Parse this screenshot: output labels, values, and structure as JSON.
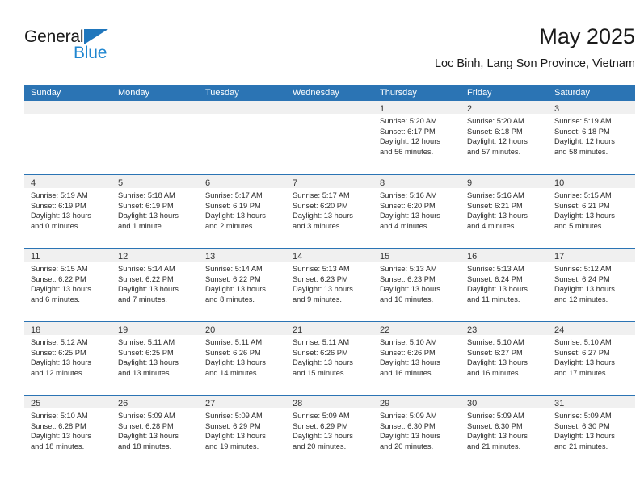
{
  "brand": {
    "name_top": "General",
    "name_bottom": "Blue",
    "triangle_color": "#1f76bc",
    "blue_text_color": "#1f86d0"
  },
  "header": {
    "month_title": "May 2025",
    "location": "Loc Binh, Lang Son Province, Vietnam"
  },
  "theme": {
    "header_blue": "#2b74b4",
    "day_band_gray": "#f0f0f0",
    "text_dark": "#2b2b2b"
  },
  "weekdays": [
    "Sunday",
    "Monday",
    "Tuesday",
    "Wednesday",
    "Thursday",
    "Friday",
    "Saturday"
  ],
  "weeks": [
    [
      {
        "day": "",
        "lines": []
      },
      {
        "day": "",
        "lines": []
      },
      {
        "day": "",
        "lines": []
      },
      {
        "day": "",
        "lines": []
      },
      {
        "day": "1",
        "lines": [
          "Sunrise: 5:20 AM",
          "Sunset: 6:17 PM",
          "Daylight: 12 hours",
          "and 56 minutes."
        ]
      },
      {
        "day": "2",
        "lines": [
          "Sunrise: 5:20 AM",
          "Sunset: 6:18 PM",
          "Daylight: 12 hours",
          "and 57 minutes."
        ]
      },
      {
        "day": "3",
        "lines": [
          "Sunrise: 5:19 AM",
          "Sunset: 6:18 PM",
          "Daylight: 12 hours",
          "and 58 minutes."
        ]
      }
    ],
    [
      {
        "day": "4",
        "lines": [
          "Sunrise: 5:19 AM",
          "Sunset: 6:19 PM",
          "Daylight: 13 hours",
          "and 0 minutes."
        ]
      },
      {
        "day": "5",
        "lines": [
          "Sunrise: 5:18 AM",
          "Sunset: 6:19 PM",
          "Daylight: 13 hours",
          "and 1 minute."
        ]
      },
      {
        "day": "6",
        "lines": [
          "Sunrise: 5:17 AM",
          "Sunset: 6:19 PM",
          "Daylight: 13 hours",
          "and 2 minutes."
        ]
      },
      {
        "day": "7",
        "lines": [
          "Sunrise: 5:17 AM",
          "Sunset: 6:20 PM",
          "Daylight: 13 hours",
          "and 3 minutes."
        ]
      },
      {
        "day": "8",
        "lines": [
          "Sunrise: 5:16 AM",
          "Sunset: 6:20 PM",
          "Daylight: 13 hours",
          "and 4 minutes."
        ]
      },
      {
        "day": "9",
        "lines": [
          "Sunrise: 5:16 AM",
          "Sunset: 6:21 PM",
          "Daylight: 13 hours",
          "and 4 minutes."
        ]
      },
      {
        "day": "10",
        "lines": [
          "Sunrise: 5:15 AM",
          "Sunset: 6:21 PM",
          "Daylight: 13 hours",
          "and 5 minutes."
        ]
      }
    ],
    [
      {
        "day": "11",
        "lines": [
          "Sunrise: 5:15 AM",
          "Sunset: 6:22 PM",
          "Daylight: 13 hours",
          "and 6 minutes."
        ]
      },
      {
        "day": "12",
        "lines": [
          "Sunrise: 5:14 AM",
          "Sunset: 6:22 PM",
          "Daylight: 13 hours",
          "and 7 minutes."
        ]
      },
      {
        "day": "13",
        "lines": [
          "Sunrise: 5:14 AM",
          "Sunset: 6:22 PM",
          "Daylight: 13 hours",
          "and 8 minutes."
        ]
      },
      {
        "day": "14",
        "lines": [
          "Sunrise: 5:13 AM",
          "Sunset: 6:23 PM",
          "Daylight: 13 hours",
          "and 9 minutes."
        ]
      },
      {
        "day": "15",
        "lines": [
          "Sunrise: 5:13 AM",
          "Sunset: 6:23 PM",
          "Daylight: 13 hours",
          "and 10 minutes."
        ]
      },
      {
        "day": "16",
        "lines": [
          "Sunrise: 5:13 AM",
          "Sunset: 6:24 PM",
          "Daylight: 13 hours",
          "and 11 minutes."
        ]
      },
      {
        "day": "17",
        "lines": [
          "Sunrise: 5:12 AM",
          "Sunset: 6:24 PM",
          "Daylight: 13 hours",
          "and 12 minutes."
        ]
      }
    ],
    [
      {
        "day": "18",
        "lines": [
          "Sunrise: 5:12 AM",
          "Sunset: 6:25 PM",
          "Daylight: 13 hours",
          "and 12 minutes."
        ]
      },
      {
        "day": "19",
        "lines": [
          "Sunrise: 5:11 AM",
          "Sunset: 6:25 PM",
          "Daylight: 13 hours",
          "and 13 minutes."
        ]
      },
      {
        "day": "20",
        "lines": [
          "Sunrise: 5:11 AM",
          "Sunset: 6:26 PM",
          "Daylight: 13 hours",
          "and 14 minutes."
        ]
      },
      {
        "day": "21",
        "lines": [
          "Sunrise: 5:11 AM",
          "Sunset: 6:26 PM",
          "Daylight: 13 hours",
          "and 15 minutes."
        ]
      },
      {
        "day": "22",
        "lines": [
          "Sunrise: 5:10 AM",
          "Sunset: 6:26 PM",
          "Daylight: 13 hours",
          "and 16 minutes."
        ]
      },
      {
        "day": "23",
        "lines": [
          "Sunrise: 5:10 AM",
          "Sunset: 6:27 PM",
          "Daylight: 13 hours",
          "and 16 minutes."
        ]
      },
      {
        "day": "24",
        "lines": [
          "Sunrise: 5:10 AM",
          "Sunset: 6:27 PM",
          "Daylight: 13 hours",
          "and 17 minutes."
        ]
      }
    ],
    [
      {
        "day": "25",
        "lines": [
          "Sunrise: 5:10 AM",
          "Sunset: 6:28 PM",
          "Daylight: 13 hours",
          "and 18 minutes."
        ]
      },
      {
        "day": "26",
        "lines": [
          "Sunrise: 5:09 AM",
          "Sunset: 6:28 PM",
          "Daylight: 13 hours",
          "and 18 minutes."
        ]
      },
      {
        "day": "27",
        "lines": [
          "Sunrise: 5:09 AM",
          "Sunset: 6:29 PM",
          "Daylight: 13 hours",
          "and 19 minutes."
        ]
      },
      {
        "day": "28",
        "lines": [
          "Sunrise: 5:09 AM",
          "Sunset: 6:29 PM",
          "Daylight: 13 hours",
          "and 20 minutes."
        ]
      },
      {
        "day": "29",
        "lines": [
          "Sunrise: 5:09 AM",
          "Sunset: 6:30 PM",
          "Daylight: 13 hours",
          "and 20 minutes."
        ]
      },
      {
        "day": "30",
        "lines": [
          "Sunrise: 5:09 AM",
          "Sunset: 6:30 PM",
          "Daylight: 13 hours",
          "and 21 minutes."
        ]
      },
      {
        "day": "31",
        "lines": [
          "Sunrise: 5:09 AM",
          "Sunset: 6:30 PM",
          "Daylight: 13 hours",
          "and 21 minutes."
        ]
      }
    ]
  ]
}
